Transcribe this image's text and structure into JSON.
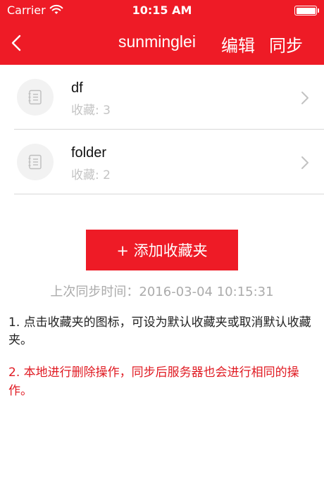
{
  "status_bar": {
    "carrier": "Carrier",
    "time": "10:15 AM"
  },
  "nav": {
    "title": "sunminglei",
    "edit_label": "编辑",
    "sync_label": "同步"
  },
  "folders": [
    {
      "name": "df",
      "count_text": "收藏: 3"
    },
    {
      "name": "folder",
      "count_text": "收藏: 2"
    }
  ],
  "add_button_label": "+ 添加收藏夹",
  "last_sync_text": "上次同步时间：2016-03-04 10:15:31",
  "tips": [
    "1. 点击收藏夹的图标，可设为默认收藏夹或取消默认收藏夹。",
    "2. 本地进行删除操作，同步后服务器也会进行相同的操作。"
  ],
  "colors": {
    "accent": "#ee1b26",
    "warning_text": "#e01a22",
    "muted_text": "#ababab"
  },
  "icons": {
    "back": "back-chevron-icon",
    "folder": "notebook-icon",
    "row_arrow": "chevron-right-icon",
    "wifi": "wifi-icon",
    "battery": "battery-icon"
  }
}
